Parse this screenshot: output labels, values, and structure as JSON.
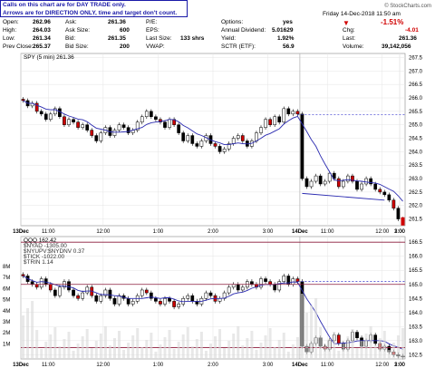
{
  "notice": {
    "line1": "Calls on this chart are for DAY TRADE only.",
    "line2": "Arrows are for DIRECTION ONLY, time and target don't count."
  },
  "watermark": "© StockCharts.com",
  "quote": {
    "open_label": "Open:",
    "open": "262.96",
    "high_label": "High:",
    "high": "264.03",
    "low_label": "Low:",
    "low": "261.34",
    "prev_label": "Prev Close:",
    "prev": "265.37",
    "ask_label": "Ask:",
    "ask": "261.36",
    "asksize_label": "Ask Size:",
    "asksize": "600",
    "bid_label": "Bid:",
    "bid": "261.35",
    "bidsize_label": "Bid Size:",
    "bidsize": "200",
    "pe_label": "P/E:",
    "pe": "",
    "eps_label": "EPS:",
    "eps": "",
    "lastsize_label": "Last Size:",
    "lastsize": "133 shrs",
    "vwap_label": "VWAP:",
    "vwap": "",
    "options_label": "Options:",
    "options": "yes",
    "div_label": "Annual Dividend:",
    "div": "5.01629",
    "yield_label": "Yield:",
    "yield": "1.92%",
    "sctr_label": "SCTR (ETF):",
    "sctr": "56.9",
    "date": "Friday 14-Dec-2018 11:50 am",
    "pct": "-1.51%",
    "chg_label": "Chg:",
    "chg": "-4.01",
    "last_label": "Last:",
    "last": "261.36",
    "vol_label": "Volume:",
    "vol": "39,142,056"
  },
  "chart_data": [
    {
      "type": "candlestick",
      "title": "SPY (5 min) 261.36",
      "x_ticks": [
        "13Dec",
        "11:00",
        "12:00",
        "1:00",
        "2:00",
        "3:00",
        "14Dec",
        "11:00",
        "12:00",
        "1:00",
        "2:00",
        "3:00"
      ],
      "y_ticks": [
        "267.5",
        "267.0",
        "266.5",
        "266.0",
        "265.5",
        "265.0",
        "264.5",
        "264.0",
        "263.5",
        "263.0",
        "262.5",
        "262.0",
        "261.5"
      ],
      "ylim": [
        261.25,
        267.65
      ],
      "prev_close_line": 265.37,
      "support_line": {
        "from": 262.45,
        "to": 262.2
      },
      "close_13dec": [
        265.9,
        265.7,
        265.8,
        265.5,
        265.4,
        265.2,
        265.4,
        265.6,
        265.3,
        265.0,
        265.2,
        265.1,
        264.9,
        265.0,
        264.8,
        264.6,
        264.4,
        264.7,
        264.9,
        264.6,
        264.8,
        265.0,
        264.9,
        264.7,
        264.8,
        265.1,
        265.3,
        265.5,
        265.3,
        265.2,
        265.1,
        264.9,
        265.2,
        265.0,
        264.7,
        264.4,
        264.6,
        264.3,
        264.2,
        264.4,
        264.6,
        264.3,
        264.2,
        264.0,
        264.1,
        264.3,
        264.5,
        264.6,
        264.4,
        264.2,
        264.4,
        264.7,
        264.9,
        265.2,
        265.0,
        265.3,
        265.1,
        265.6,
        265.4,
        265.5,
        265.4
      ],
      "close_14dec": [
        263.0,
        262.7,
        262.9,
        263.1,
        262.8,
        262.9,
        263.2,
        263.0,
        262.7,
        262.9,
        263.1,
        262.9,
        262.6,
        262.8,
        263.0,
        262.8,
        262.6,
        262.5,
        262.4,
        262.2,
        261.9,
        261.5,
        261.36
      ]
    },
    {
      "type": "candlestick",
      "title": "QQQ 162.42",
      "overlays": [
        "$NYAD -1305.00",
        "$NYUPV:$NYDNV 0.37",
        "$TICK -1022.00",
        "$TRIN 1.14"
      ],
      "x_ticks": [
        "13Dec",
        "11:00",
        "12:00",
        "1:00",
        "2:00",
        "3:00",
        "14Dec",
        "11:00",
        "12:00",
        "1:00",
        "2:00",
        "3:00"
      ],
      "y_ticks": [
        "166.5",
        "166.0",
        "165.5",
        "165.0",
        "164.5",
        "164.0",
        "163.5",
        "163.0",
        "162.5"
      ],
      "ylim": [
        162.35,
        166.7
      ],
      "volume_ticks": [
        "8M",
        "7M",
        "6M",
        "5M",
        "4M",
        "3M",
        "2M",
        "1M"
      ],
      "levels": [
        166.5,
        165.0,
        162.75
      ],
      "prev_close_line": 165.1,
      "close_13dec": [
        165.3,
        165.1,
        165.0,
        164.9,
        165.2,
        165.0,
        164.8,
        164.6,
        164.9,
        165.1,
        164.8,
        164.6,
        164.5,
        164.7,
        164.9,
        164.6,
        164.4,
        164.6,
        164.8,
        164.5,
        164.3,
        164.6,
        164.5,
        164.3,
        164.4,
        164.6,
        164.8,
        164.7,
        164.5,
        164.4,
        164.3,
        164.5,
        164.4,
        164.2,
        164.3,
        164.5,
        164.6,
        164.4,
        164.3,
        164.5,
        164.7,
        164.6,
        164.4,
        164.5,
        164.7,
        164.9,
        165.0,
        164.8,
        164.9,
        165.1,
        165.0,
        164.9,
        165.2,
        165.1,
        165.0,
        164.8,
        165.1,
        165.3,
        165.0,
        165.2,
        165.1
      ],
      "close_14dec": [
        162.8,
        162.6,
        162.9,
        163.1,
        162.8,
        162.7,
        163.0,
        163.2,
        162.9,
        162.7,
        163.0,
        163.3,
        163.1,
        162.8,
        163.0,
        163.2,
        162.9,
        162.7,
        162.8,
        162.6,
        162.5,
        162.45,
        162.42
      ]
    }
  ]
}
